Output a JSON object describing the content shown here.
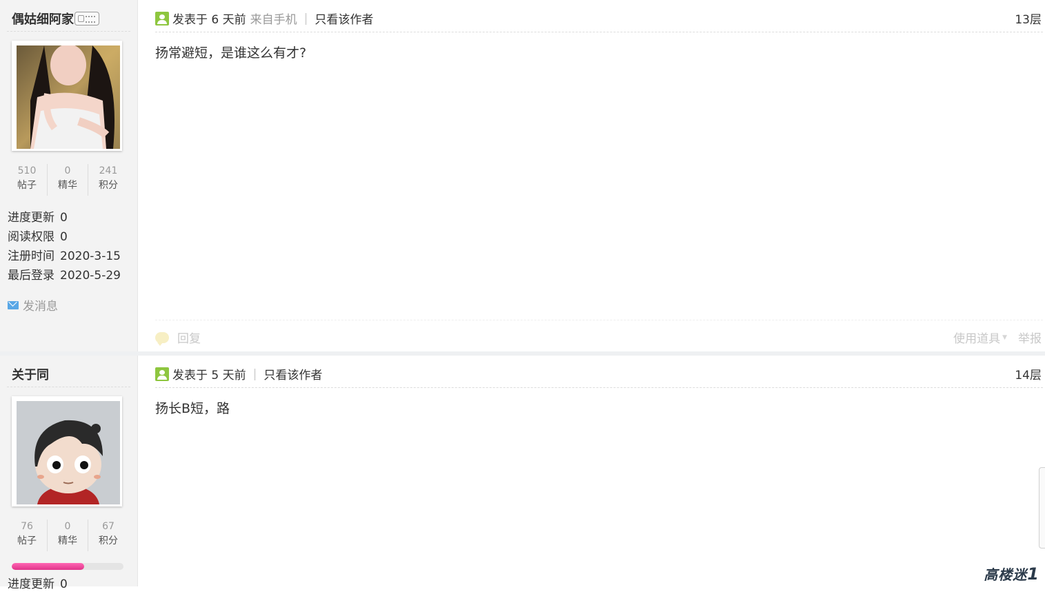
{
  "posts": [
    {
      "username": "偶姑细阿家",
      "stats": [
        {
          "value": "510",
          "label": "帖子"
        },
        {
          "value": "0",
          "label": "精华"
        },
        {
          "value": "241",
          "label": "积分"
        }
      ],
      "info": [
        {
          "label": "进度更新",
          "value": "0"
        },
        {
          "label": "阅读权限",
          "value": "0"
        },
        {
          "label": "注册时间",
          "value": "2020-3-15"
        },
        {
          "label": "最后登录",
          "value": "2020-5-29"
        }
      ],
      "send_message": "发消息",
      "posted": "发表于 6 天前",
      "from": "来自手机",
      "only_author": "只看该作者",
      "floor": "13层",
      "content": "扬常避短，是谁这么有才?",
      "reply": "回复",
      "use_tool": "使用道具",
      "report": "举报"
    },
    {
      "username": "关于同",
      "stats": [
        {
          "value": "76",
          "label": "帖子"
        },
        {
          "value": "0",
          "label": "精华"
        },
        {
          "value": "67",
          "label": "积分"
        }
      ],
      "progress_fraction": 0.65,
      "info_partial": {
        "label": "进度更新",
        "value": "0"
      },
      "posted": "发表于 5 天前",
      "only_author": "只看该作者",
      "floor": "14层",
      "content": "扬长B短，路"
    }
  ],
  "watermark": {
    "text": "高楼迷",
    "digit": "1"
  },
  "colors": {
    "online": "#8ec63f",
    "progress": "#e0338a",
    "mail": "#59a7e6"
  }
}
